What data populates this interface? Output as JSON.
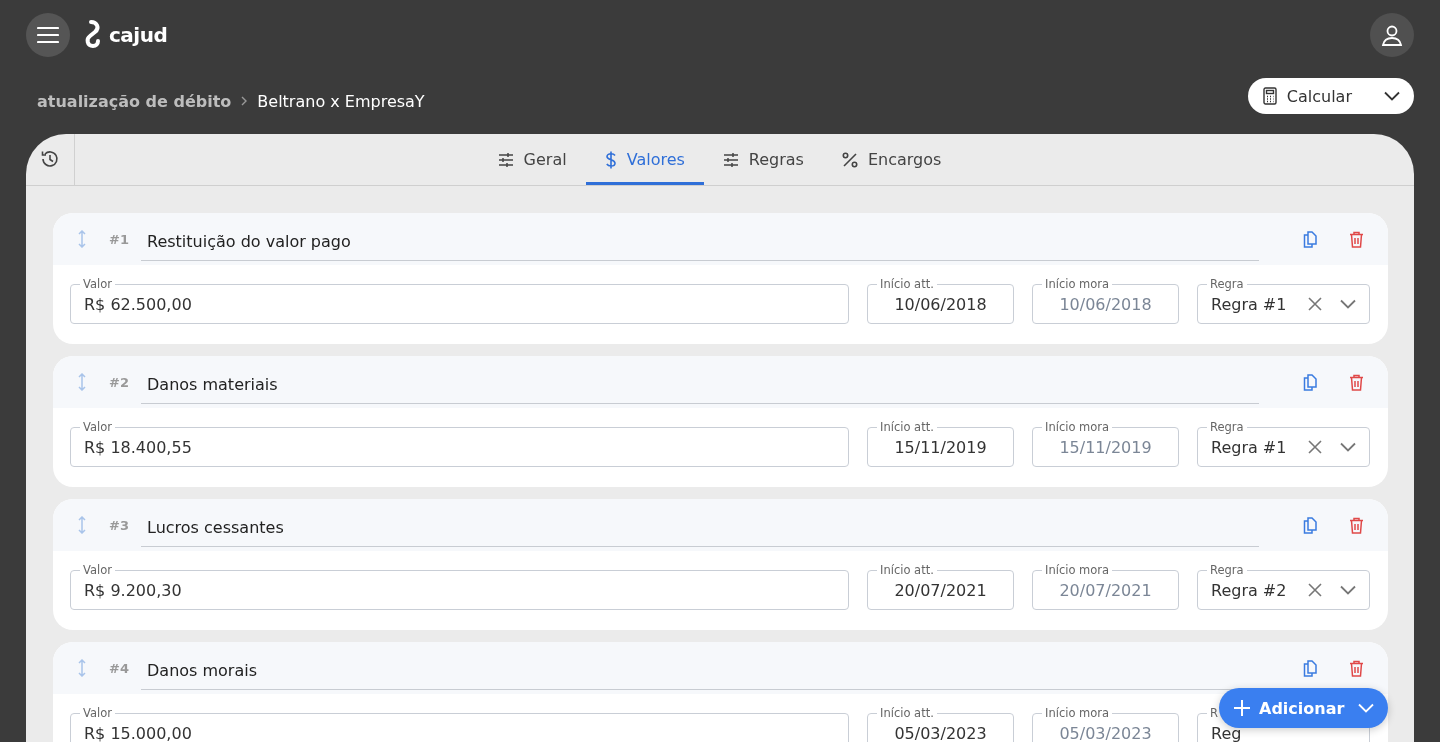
{
  "app": {
    "logo": "cajud"
  },
  "breadcrumb": [
    {
      "label": "atualização de débito"
    },
    {
      "label": "Beltrano x EmpresaY"
    }
  ],
  "calculate_button": {
    "label": "Calcular"
  },
  "tabs": [
    {
      "label": "Geral",
      "selected": false
    },
    {
      "label": "Valores",
      "selected": true
    },
    {
      "label": "Regras",
      "selected": false
    },
    {
      "label": "Encargos",
      "selected": false
    }
  ],
  "items": [
    {
      "number": "#1",
      "title": "Restituição do valor pago",
      "fields": [
        {
          "kind": "amount",
          "label": "Valor",
          "value": "R$ 62.500,00"
        },
        {
          "kind": "date",
          "label": "Início att.",
          "value": "10/06/2018",
          "disabled": false
        },
        {
          "kind": "date",
          "label": "Início mora",
          "value": "10/06/2018",
          "disabled": true
        },
        {
          "kind": "select",
          "label": "Regra",
          "value": "Regra #1",
          "controls_visible": true
        }
      ]
    },
    {
      "number": "#2",
      "title": "Danos materiais",
      "fields": [
        {
          "kind": "amount",
          "label": "Valor",
          "value": "R$ 18.400,55"
        },
        {
          "kind": "date",
          "label": "Início att.",
          "value": "15/11/2019",
          "disabled": false
        },
        {
          "kind": "date",
          "label": "Início mora",
          "value": "15/11/2019",
          "disabled": true
        },
        {
          "kind": "select",
          "label": "Regra",
          "value": "Regra #1",
          "controls_visible": true
        }
      ]
    },
    {
      "number": "#3",
      "title": "Lucros cessantes",
      "fields": [
        {
          "kind": "amount",
          "label": "Valor",
          "value": "R$ 9.200,30"
        },
        {
          "kind": "date",
          "label": "Início att.",
          "value": "20/07/2021",
          "disabled": false
        },
        {
          "kind": "date",
          "label": "Início mora",
          "value": "20/07/2021",
          "disabled": true
        },
        {
          "kind": "select",
          "label": "Regra",
          "value": "Regra #2",
          "controls_visible": true
        }
      ]
    },
    {
      "number": "#4",
      "title": "Danos morais",
      "fields": [
        {
          "kind": "amount",
          "label": "Valor",
          "value": "R$ 15.000,00"
        },
        {
          "kind": "date",
          "label": "Início att.",
          "value": "05/03/2023",
          "disabled": false
        },
        {
          "kind": "date",
          "label": "Início mora",
          "value": "05/03/2023",
          "disabled": true
        },
        {
          "kind": "select",
          "label": "R",
          "value": "Reg",
          "controls_visible": false
        }
      ]
    }
  ],
  "add_button": {
    "label": "Adicionar"
  }
}
